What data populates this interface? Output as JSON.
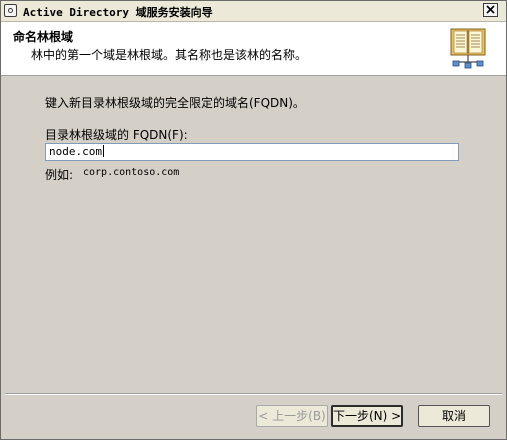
{
  "window": {
    "title": "Active Directory 域服务安装向导",
    "close_symbol": "×"
  },
  "header": {
    "title": "命名林根域",
    "subtitle": "林中的第一个域是林根域。其名称也是该林的名称。",
    "icon": "book-network-icon"
  },
  "content": {
    "instruction": "键入新目录林根级域的完全限定的域名(FQDN)。",
    "fqdn_label": "目录林根级域的 FQDN(F):",
    "fqdn_value": "node.com",
    "example_label": "例如:",
    "example_value": "corp.contoso.com"
  },
  "buttons": {
    "back": "< 上一步(B)",
    "next": "下一步(N) >",
    "cancel": "取消"
  }
}
